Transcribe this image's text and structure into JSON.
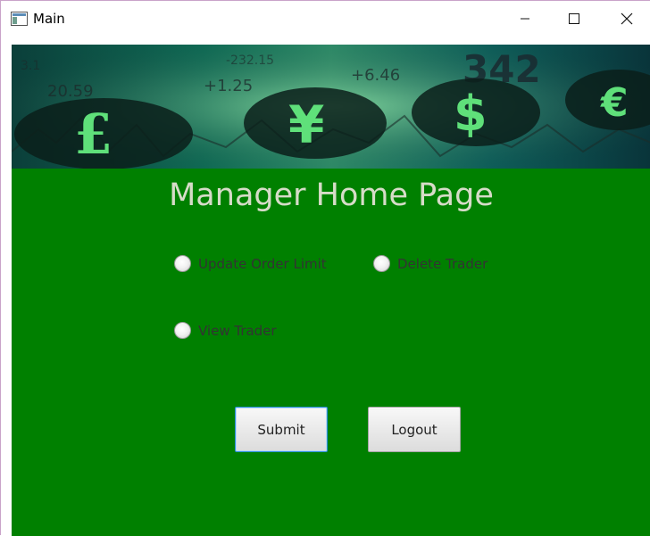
{
  "window": {
    "title": "Main",
    "controls": {
      "minimize": "minimize",
      "maximize": "maximize",
      "close": "close"
    }
  },
  "banner": {
    "numbers": [
      "20.59",
      "+1.25",
      "+6.46",
      "342",
      "3.1",
      "-232.15"
    ],
    "currency_symbols": [
      "£",
      "¥",
      "$",
      "€"
    ],
    "colors": {
      "symbol_green": "#5fe07a",
      "symbol_dark": "#0a1e1a"
    }
  },
  "page": {
    "heading": "Manager Home Page",
    "background_color": "#008000"
  },
  "options": {
    "update_order_limit": "Update Order Limit",
    "delete_trader": "Delete Trader",
    "view_trader": "View Trader"
  },
  "buttons": {
    "submit": "Submit",
    "logout": "Logout"
  }
}
